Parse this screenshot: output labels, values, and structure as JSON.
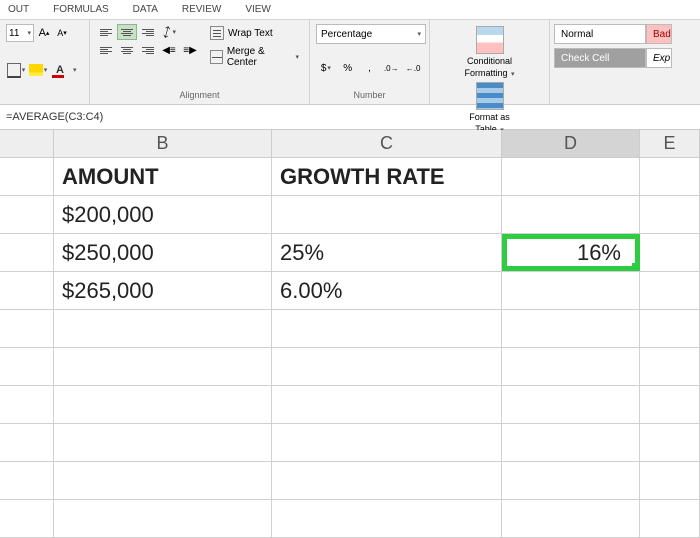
{
  "tabs": {
    "layout": "OUT",
    "formulas": "FORMULAS",
    "data": "DATA",
    "review": "REVIEW",
    "view": "VIEW"
  },
  "ribbon": {
    "font": {
      "size": "11",
      "incA": "A",
      "decA": "A"
    },
    "alignment": {
      "label": "Alignment",
      "wrap": "Wrap Text",
      "merge": "Merge & Center"
    },
    "number": {
      "label": "Number",
      "format": "Percentage",
      "currency": "$",
      "percent": "%",
      "comma": ",",
      "dec_inc": ".0",
      "dec_dec": ".00"
    },
    "styles": {
      "cond_fmt": "Conditional",
      "cond_fmt2": "Formatting",
      "fmt_table": "Format as",
      "fmt_table2": "Table"
    },
    "cell_styles": {
      "normal": "Normal",
      "bad": "Bad",
      "check": "Check Cell",
      "exp": "Exp"
    }
  },
  "formula_bar": "=AVERAGE(C3:C4)",
  "headers": {
    "B": "B",
    "C": "C",
    "D": "D",
    "E": "E"
  },
  "rows": {
    "r1": {
      "B": "AMOUNT",
      "C": "GROWTH RATE",
      "D": ""
    },
    "r2": {
      "B": "$200,000",
      "C": "",
      "D": ""
    },
    "r3": {
      "B": "$250,000",
      "C": "25%",
      "D": "16%"
    },
    "r4": {
      "B": "$265,000",
      "C": "6.00%",
      "D": ""
    }
  }
}
